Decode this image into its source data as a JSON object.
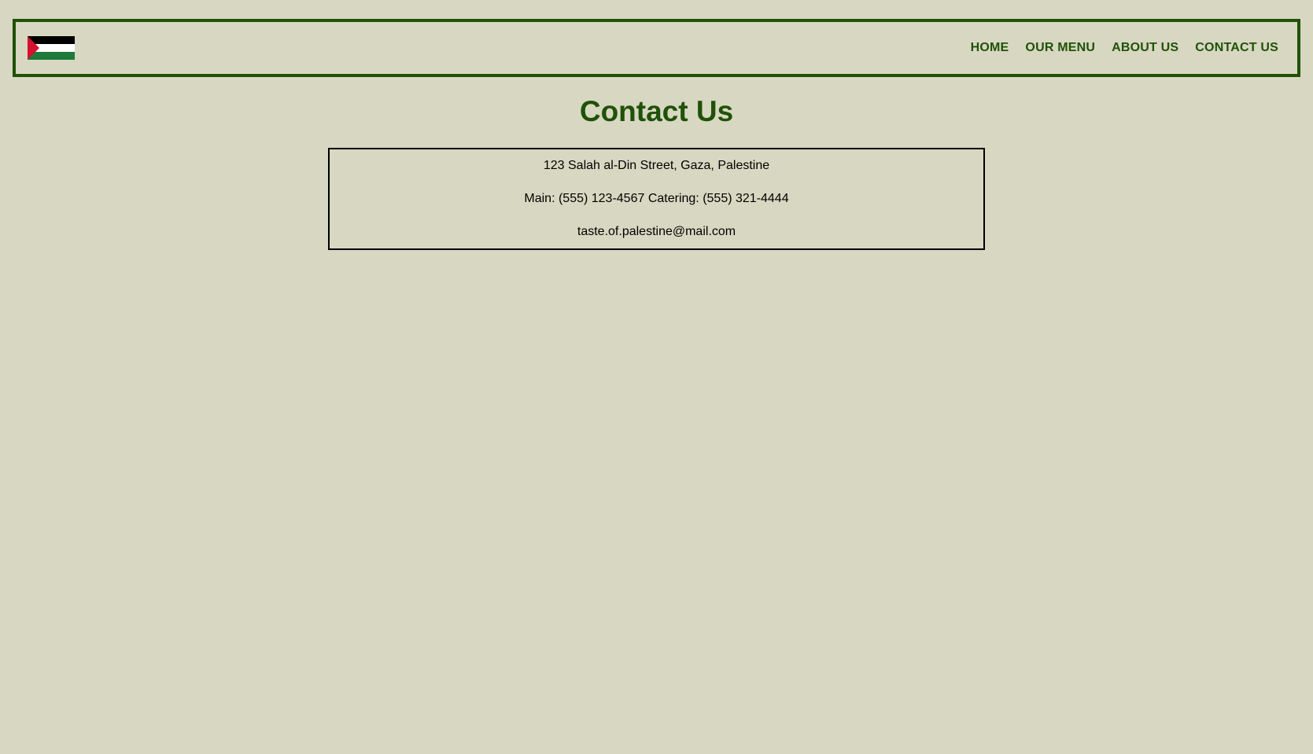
{
  "header": {
    "logo": "palestine-flag",
    "nav": [
      {
        "label": "HOME"
      },
      {
        "label": "OUR MENU"
      },
      {
        "label": "ABOUT US"
      },
      {
        "label": "CONTACT US"
      }
    ]
  },
  "main": {
    "title": "Contact Us",
    "contact": {
      "address": "123 Salah al-Din Street, Gaza, Palestine",
      "phones": "Main: (555) 123-4567 Catering: (555) 321-4444",
      "email": "taste.of.palestine@mail.com"
    }
  },
  "colors": {
    "background": "#d8d7c1",
    "accent": "#1f5209",
    "text": "#000000"
  }
}
